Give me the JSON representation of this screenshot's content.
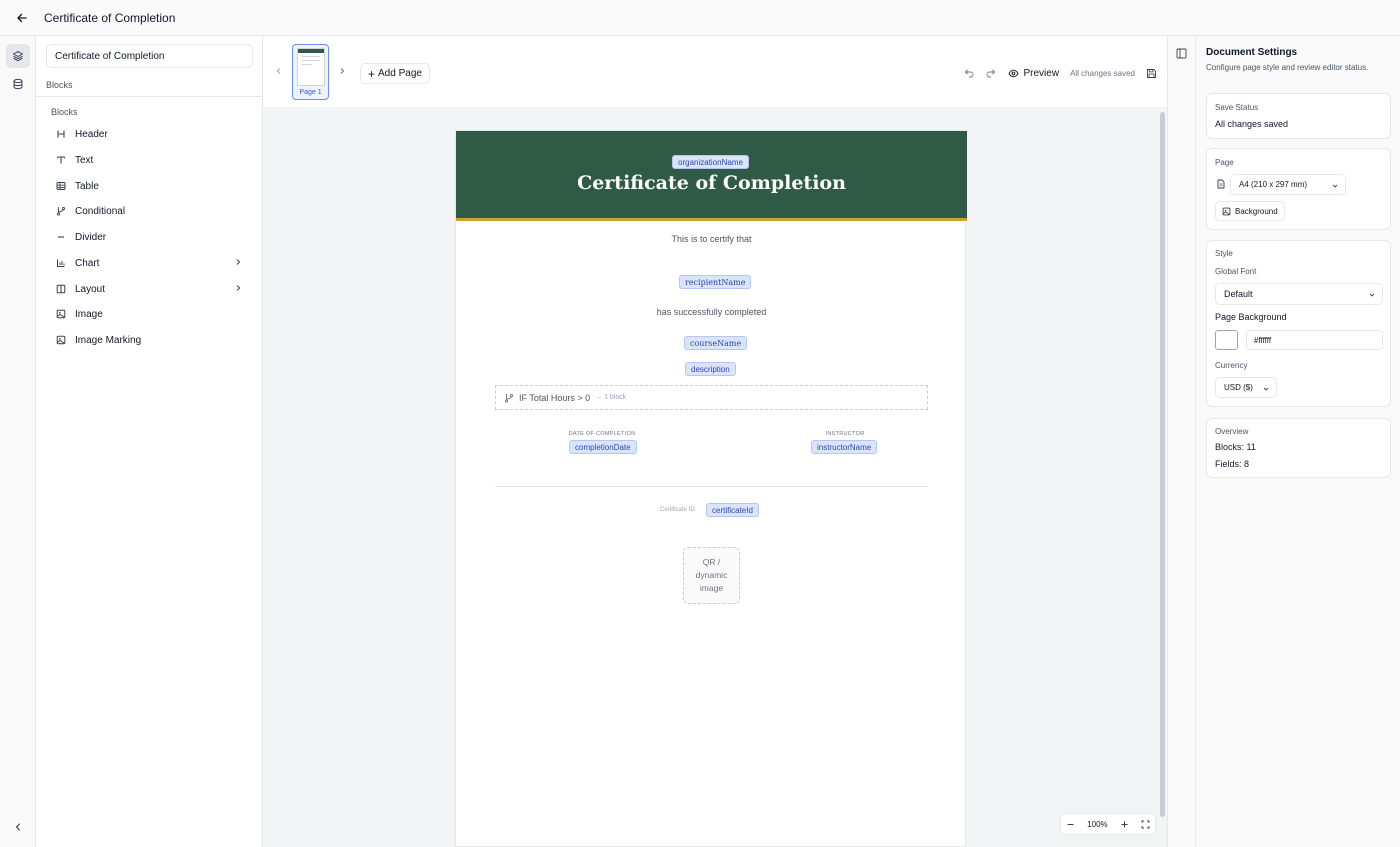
{
  "window": {
    "title": "Certificate of Completion"
  },
  "left_panel": {
    "document_name": "Certificate of Completion",
    "section_title": "Blocks",
    "subsection_title": "Blocks",
    "items": [
      {
        "label": "Header",
        "icon": "heading-icon"
      },
      {
        "label": "Text",
        "icon": "text-icon"
      },
      {
        "label": "Table",
        "icon": "table-icon"
      },
      {
        "label": "Conditional",
        "icon": "branch-icon"
      },
      {
        "label": "Divider",
        "icon": "minus-icon"
      },
      {
        "label": "Chart",
        "icon": "bar-chart-icon"
      },
      {
        "label": "Layout",
        "icon": "columns-icon"
      },
      {
        "label": "Image",
        "icon": "image-icon"
      },
      {
        "label": "Image Marking",
        "icon": "image-icon"
      }
    ]
  },
  "pages_bar": {
    "thumbnail_label": "Page 1",
    "add_page_label": "Add Page",
    "preview_label": "Preview",
    "save_status": "All changes saved"
  },
  "page": {
    "header_field": "organizationName",
    "title": "Certificate of Completion",
    "certify_text": "This is to certify that",
    "recipient_field": "recipientName",
    "completed_text": "has successfully completed",
    "course_field": "courseName",
    "description_field": "description",
    "conditional": {
      "text": "IF Total Hours > 0",
      "hint": "→ 1 block"
    },
    "date_label": "DATE OF COMPLETION",
    "date_field": "completionDate",
    "instructor_label": "INSTRUCTOR",
    "instructor_field": "instructorName",
    "certificate_id_label": "Certificate ID:",
    "certificate_id_field": "certificateId",
    "qr_placeholder": "QR / dynamic image",
    "header_color": "#2f5a45",
    "accent_color": "#c9a227"
  },
  "zoom": {
    "level": "100%"
  },
  "settings": {
    "title": "Document Settings",
    "subtitle": "Configure page style and review editor status.",
    "save_status_label": "Save Status",
    "save_status_value": "All changes saved",
    "page_label": "Page",
    "page_size": "A4 (210 x 297 mm)",
    "background_label": "Background",
    "style_label": "Style",
    "global_font_label": "Global Font",
    "global_font_value": "Default",
    "page_background_label": "Page Background",
    "page_background_value": "#ffffff",
    "currency_label": "Currency",
    "currency_value": "USD ($)",
    "overview_label": "Overview",
    "blocks_count": "Blocks: 11",
    "fields_count": "Fields: 8"
  }
}
